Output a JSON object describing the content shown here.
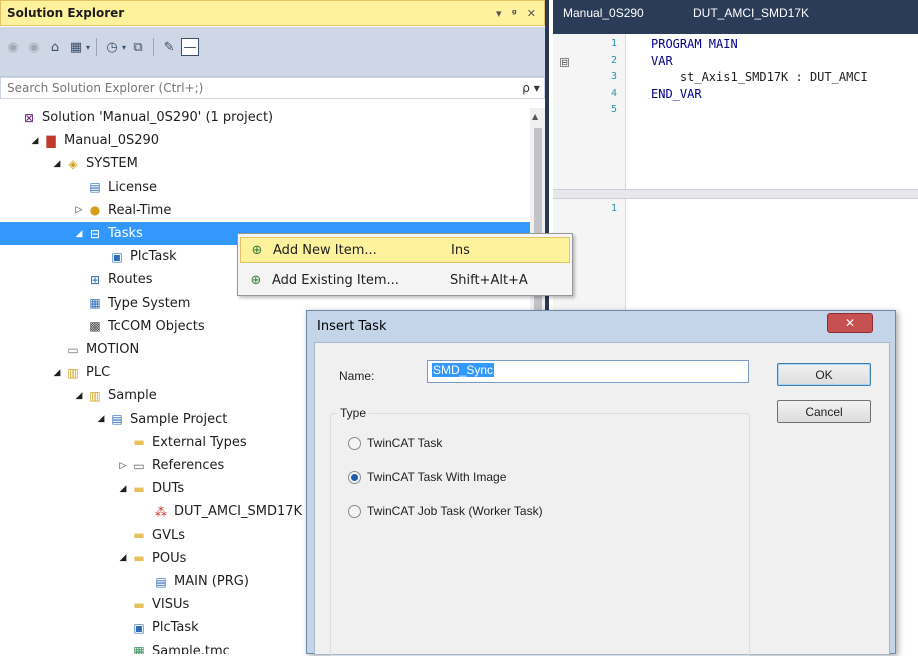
{
  "solution_explorer": {
    "title": "Solution Explorer",
    "title_buttons": [
      "▾",
      "ᵍ",
      "✕"
    ],
    "search_placeholder": "Search Solution Explorer (Ctrl+;)",
    "search_icon": "ρ ▾",
    "tree": [
      {
        "label": "Solution 'Manual_0S290' (1 project)",
        "icon": "solution-icon",
        "glyph": "⊠",
        "color": "#68217a",
        "expander": "",
        "indent": 0
      },
      {
        "label": "Manual_0S290",
        "icon": "twincat-project-icon",
        "glyph": "▇",
        "color": "#c0392b",
        "expander": "◢",
        "indent": 1
      },
      {
        "label": "SYSTEM",
        "icon": "system-icon",
        "glyph": "◈",
        "color": "#d4a017",
        "expander": "◢",
        "indent": 2
      },
      {
        "label": "License",
        "icon": "license-icon",
        "glyph": "▤",
        "color": "#2e6db4",
        "expander": "",
        "indent": 3
      },
      {
        "label": "Real-Time",
        "icon": "real-time-icon",
        "glyph": "●",
        "color": "#d4a017",
        "expander": "▷",
        "indent": 3
      },
      {
        "label": "Tasks",
        "icon": "tasks-icon",
        "glyph": "⊟",
        "color": "#ffffff",
        "expander": "◢",
        "indent": 3,
        "selected": true
      },
      {
        "label": "PlcTask",
        "icon": "plc-task-icon",
        "glyph": "▣",
        "color": "#2e6db4",
        "expander": "",
        "indent": 4
      },
      {
        "label": "Routes",
        "icon": "routes-icon",
        "glyph": "⊞",
        "color": "#2e6db4",
        "expander": "",
        "indent": 3
      },
      {
        "label": "Type System",
        "icon": "type-system-icon",
        "glyph": "▦",
        "color": "#2e6db4",
        "expander": "",
        "indent": 3
      },
      {
        "label": "TcCOM Objects",
        "icon": "tccom-objects-icon",
        "glyph": "▩",
        "color": "#444444",
        "expander": "",
        "indent": 3
      },
      {
        "label": "MOTION",
        "icon": "motion-icon",
        "glyph": "▭",
        "color": "#777777",
        "expander": "",
        "indent": 2
      },
      {
        "label": "PLC",
        "icon": "plc-icon",
        "glyph": "▥",
        "color": "#d4a017",
        "expander": "◢",
        "indent": 2
      },
      {
        "label": "Sample",
        "icon": "plc-project-icon",
        "glyph": "▥",
        "color": "#d4a017",
        "expander": "◢",
        "indent": 3
      },
      {
        "label": "Sample Project",
        "icon": "sample-project-icon",
        "glyph": "▤",
        "color": "#2e6db4",
        "expander": "◢",
        "indent": 4
      },
      {
        "label": "External Types",
        "icon": "folder-icon",
        "glyph": "▬",
        "color": "#e8c15a",
        "expander": "",
        "indent": 5
      },
      {
        "label": "References",
        "icon": "references-icon",
        "glyph": "▭",
        "color": "#666666",
        "expander": "▷",
        "indent": 5
      },
      {
        "label": "DUTs",
        "icon": "folder-open-icon",
        "glyph": "▬",
        "color": "#e8c15a",
        "expander": "◢",
        "indent": 5
      },
      {
        "label": "DUT_AMCI_SMD17K",
        "icon": "dut-icon",
        "glyph": "⁂",
        "color": "#c0392b",
        "expander": "",
        "indent": 6
      },
      {
        "label": "GVLs",
        "icon": "folder-icon",
        "glyph": "▬",
        "color": "#e8c15a",
        "expander": "",
        "indent": 5
      },
      {
        "label": "POUs",
        "icon": "folder-open-icon",
        "glyph": "▬",
        "color": "#e8c15a",
        "expander": "◢",
        "indent": 5
      },
      {
        "label": "MAIN (PRG)",
        "icon": "program-icon",
        "glyph": "▤",
        "color": "#2e6db4",
        "expander": "",
        "indent": 6
      },
      {
        "label": "VISUs",
        "icon": "folder-icon",
        "glyph": "▬",
        "color": "#e8c15a",
        "expander": "",
        "indent": 5
      },
      {
        "label": "PlcTask",
        "icon": "plc-task-icon",
        "glyph": "▣",
        "color": "#2e6db4",
        "expander": "",
        "indent": 5
      },
      {
        "label": "Sample.tmc",
        "icon": "tmc-file-icon",
        "glyph": "▦",
        "color": "#2e8b57",
        "expander": "",
        "indent": 5
      }
    ]
  },
  "editor": {
    "tabs": [
      "Manual_0S290",
      "DUT_AMCI_SMD17K"
    ],
    "top_lines": [
      {
        "n": "1",
        "code": "PROGRAM MAIN",
        "kw": true
      },
      {
        "n": "2",
        "code": "VAR",
        "kw": true,
        "fold": "⊟"
      },
      {
        "n": "3",
        "code": "    st_Axis1_SMD17K : DUT_AMCI",
        "kw": false
      },
      {
        "n": "4",
        "code": "END_VAR",
        "kw": true
      },
      {
        "n": "5",
        "code": "",
        "kw": false
      }
    ],
    "bottom_lines": [
      {
        "n": "1",
        "code": ""
      }
    ]
  },
  "context_menu": {
    "items": [
      {
        "label": "Add New Item...",
        "shortcut": "Ins",
        "glyph": "⊕",
        "highlighted": true
      },
      {
        "label": "Add Existing Item...",
        "shortcut": "Shift+Alt+A",
        "glyph": "⊕",
        "highlighted": false
      }
    ]
  },
  "dialog": {
    "title": "Insert Task",
    "close_label": "✕",
    "name_label": "Name:",
    "name_value": "SMD_Sync",
    "ok_label": "OK",
    "cancel_label": "Cancel",
    "type_legend": "Type",
    "options": [
      {
        "label": "TwinCAT Task",
        "checked": false
      },
      {
        "label": "TwinCAT Task With Image",
        "checked": true
      },
      {
        "label": "TwinCAT Job Task (Worker Task)",
        "checked": false
      }
    ]
  },
  "colors": {
    "accent": "#3399ff",
    "title_highlight": "#fff29d",
    "editor_tab_bg": "#2b3c59",
    "keyword": "#00008b",
    "line_number": "#2b91af"
  }
}
